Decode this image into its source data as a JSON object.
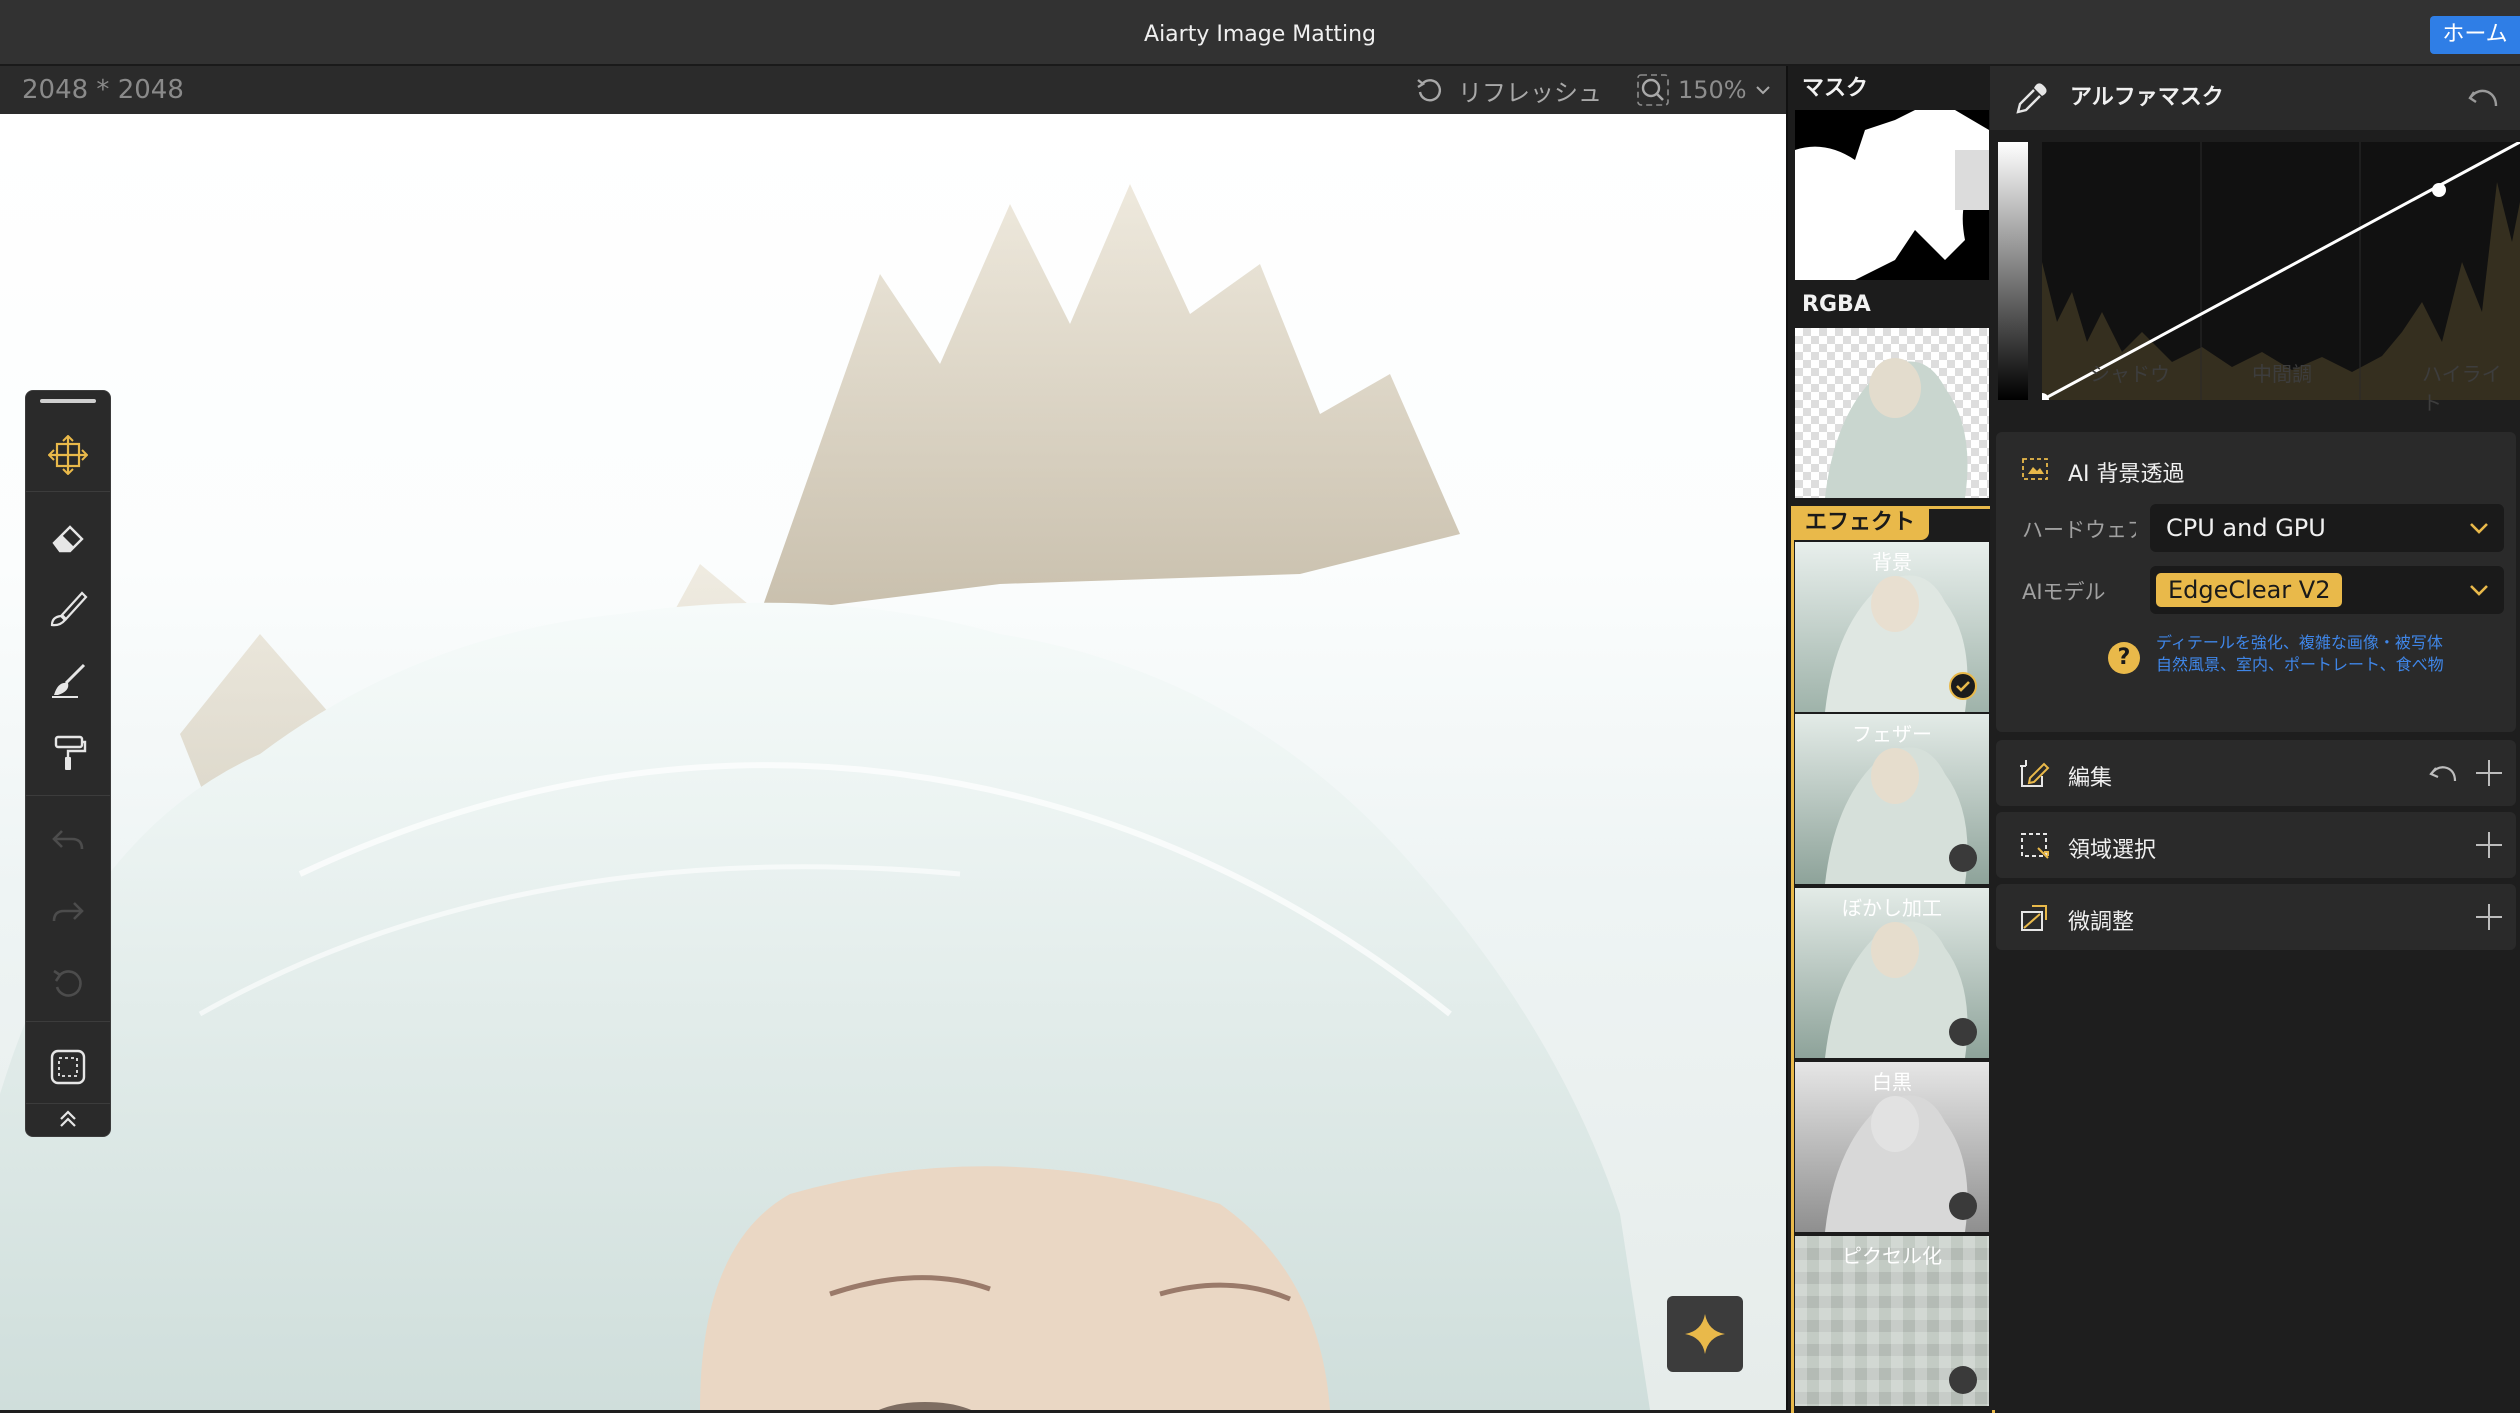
{
  "app": {
    "title": "Aiarty Image Matting",
    "home_label": "ホーム"
  },
  "toolbar": {
    "dimensions": "2048 * 2048",
    "refresh_label": "リフレッシュ",
    "zoom": "150%"
  },
  "thumbnails": {
    "mask_label": "マスク",
    "rgba_label": "RGBA",
    "effects_label": "エフェクト",
    "effects": [
      {
        "name": "背景",
        "selected": true
      },
      {
        "name": "フェザー",
        "selected": false
      },
      {
        "name": "ぼかし加工",
        "selected": false
      },
      {
        "name": "白黒",
        "selected": false
      },
      {
        "name": "ピクセル化",
        "selected": false
      }
    ]
  },
  "alpha_mask": {
    "title": "アルファマスク",
    "axis": [
      "シャドウ",
      "中間調",
      "ハイライト"
    ]
  },
  "ai_section": {
    "title": "AI 背景透過",
    "hardware_label": "ハードウェア",
    "hardware_value": "CPU and GPU",
    "model_label": "AIモデル",
    "model_value": "EdgeClear  V2",
    "hint_line1": "ディテールを強化、複雑な画像・被写体",
    "hint_line2": "自然風景、室内、ポートレート、食べ物"
  },
  "sections": {
    "edit": "編集",
    "region": "領域選択",
    "fine": "微調整"
  },
  "colors": {
    "accent": "#e9b94a",
    "home_button": "#2f7ee6",
    "hint_text": "#3f86e8"
  },
  "icons": [
    "undo-icon",
    "search-icon",
    "move-icon",
    "eraser-icon",
    "brush-icon",
    "paint-icon",
    "roller-icon",
    "redo-icon",
    "reset-icon",
    "selection-icon",
    "collapse-icon",
    "sparkle-icon",
    "eyedropper-icon",
    "ai-icon",
    "edit-icon",
    "region-icon",
    "adjust-icon",
    "check-icon",
    "help-icon",
    "chevron-down-icon"
  ]
}
